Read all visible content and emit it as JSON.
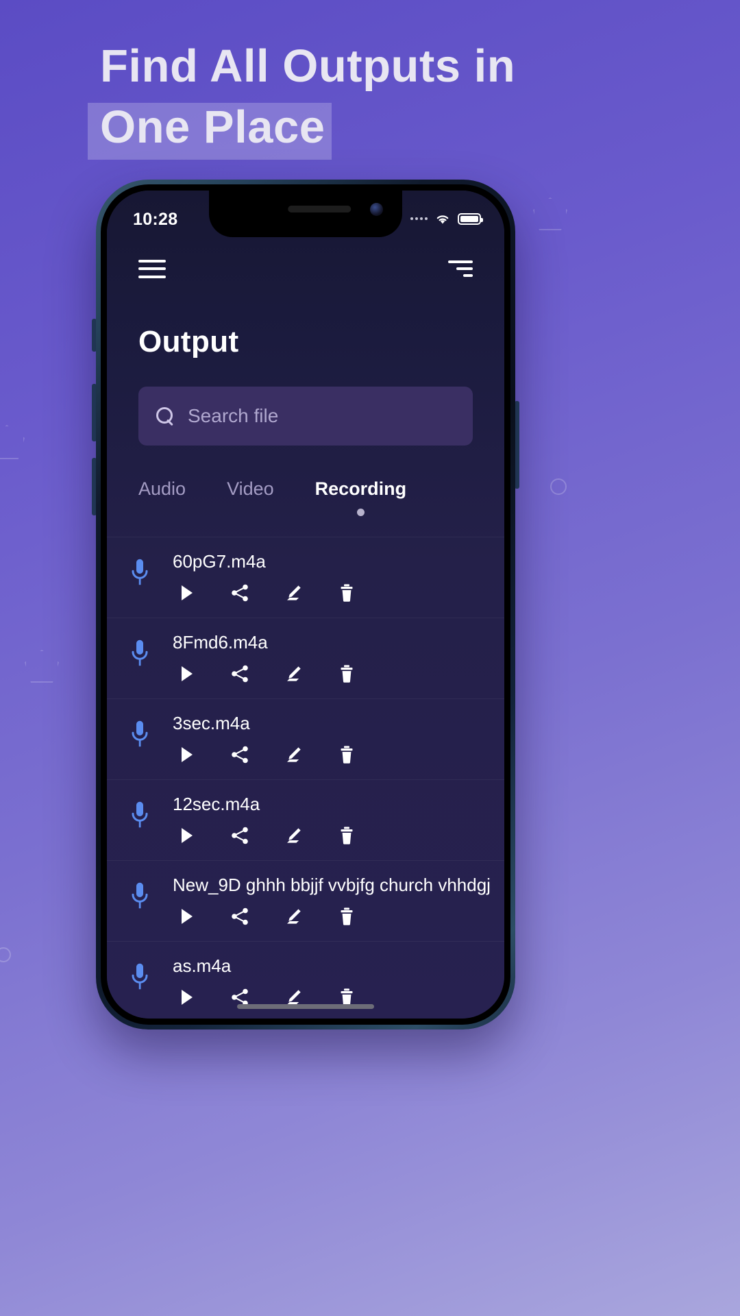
{
  "headline": {
    "line1": "Find All Outputs in",
    "line2": "One Place"
  },
  "status_bar": {
    "time": "10:28",
    "signal_icon": "signal-dots-icon",
    "wifi_icon": "wifi-icon",
    "battery_icon": "battery-full-icon"
  },
  "appbar": {
    "menu_icon": "hamburger-menu-icon",
    "sort_icon": "sort-icon"
  },
  "page": {
    "title": "Output"
  },
  "search": {
    "placeholder": "Search file",
    "value": "",
    "icon": "search-icon"
  },
  "tabs": [
    {
      "label": "Audio",
      "active": false
    },
    {
      "label": "Video",
      "active": false
    },
    {
      "label": "Recording",
      "active": true
    }
  ],
  "actions": [
    {
      "name": "play-icon",
      "label": "Play"
    },
    {
      "name": "share-icon",
      "label": "Share"
    },
    {
      "name": "edit-icon",
      "label": "Rename"
    },
    {
      "name": "delete-icon",
      "label": "Delete"
    }
  ],
  "files": [
    {
      "name": "60pG7.m4a",
      "type_icon": "microphone-icon"
    },
    {
      "name": "8Fmd6.m4a",
      "type_icon": "microphone-icon"
    },
    {
      "name": "3sec.m4a",
      "type_icon": "microphone-icon"
    },
    {
      "name": "12sec.m4a",
      "type_icon": "microphone-icon"
    },
    {
      "name": "New_9D ghhh bbjjf vvbjfg church vhhdgj",
      "type_icon": "microphone-icon"
    },
    {
      "name": "as.m4a",
      "type_icon": "microphone-icon"
    }
  ],
  "colors": {
    "background_start": "#5b4cc4",
    "background_end": "#a9a6dd",
    "app_background": "#241f4c",
    "search_field": "#3a2f63",
    "mic_accent": "#5b8df0",
    "headline_text": "#e8e6f2",
    "tab_inactive": "#a49cc4"
  }
}
